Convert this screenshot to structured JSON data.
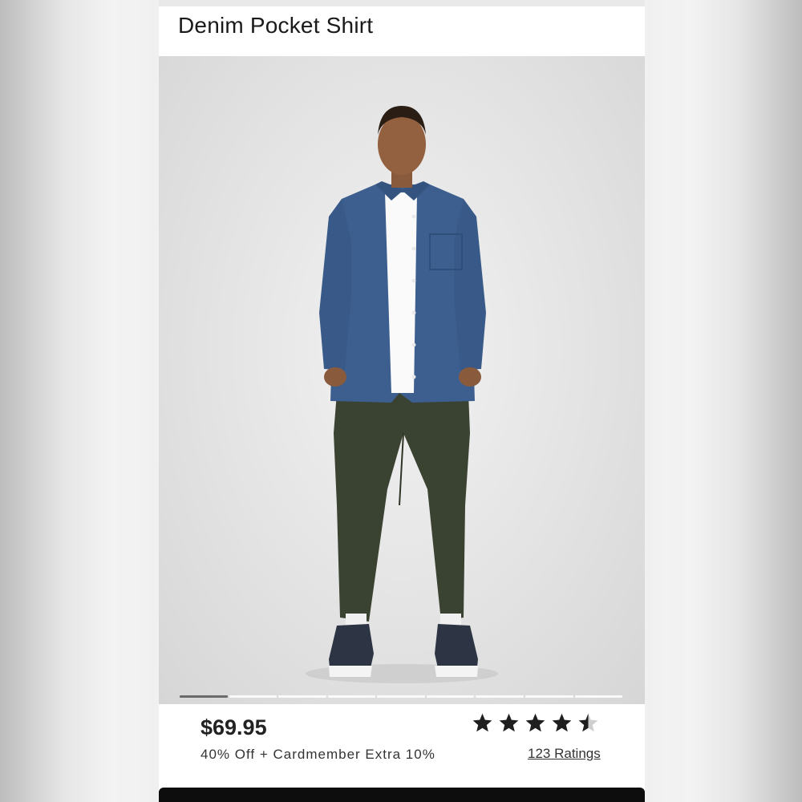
{
  "product": {
    "title": "Denim Pocket Shirt",
    "price": "$69.95",
    "promo": "40% Off + Cardmember Extra 10%",
    "rating_value": 4.5,
    "rating_max": 5,
    "ratings_label": "123 Ratings"
  },
  "carousel": {
    "image_count": 9,
    "active_index": 0
  },
  "colors": {
    "shirt": "#3c5f8f",
    "pants": "#3a4231",
    "star": "#1f1f1f"
  },
  "icons": {
    "star_full": "star-icon",
    "star_half": "star-half-icon"
  }
}
